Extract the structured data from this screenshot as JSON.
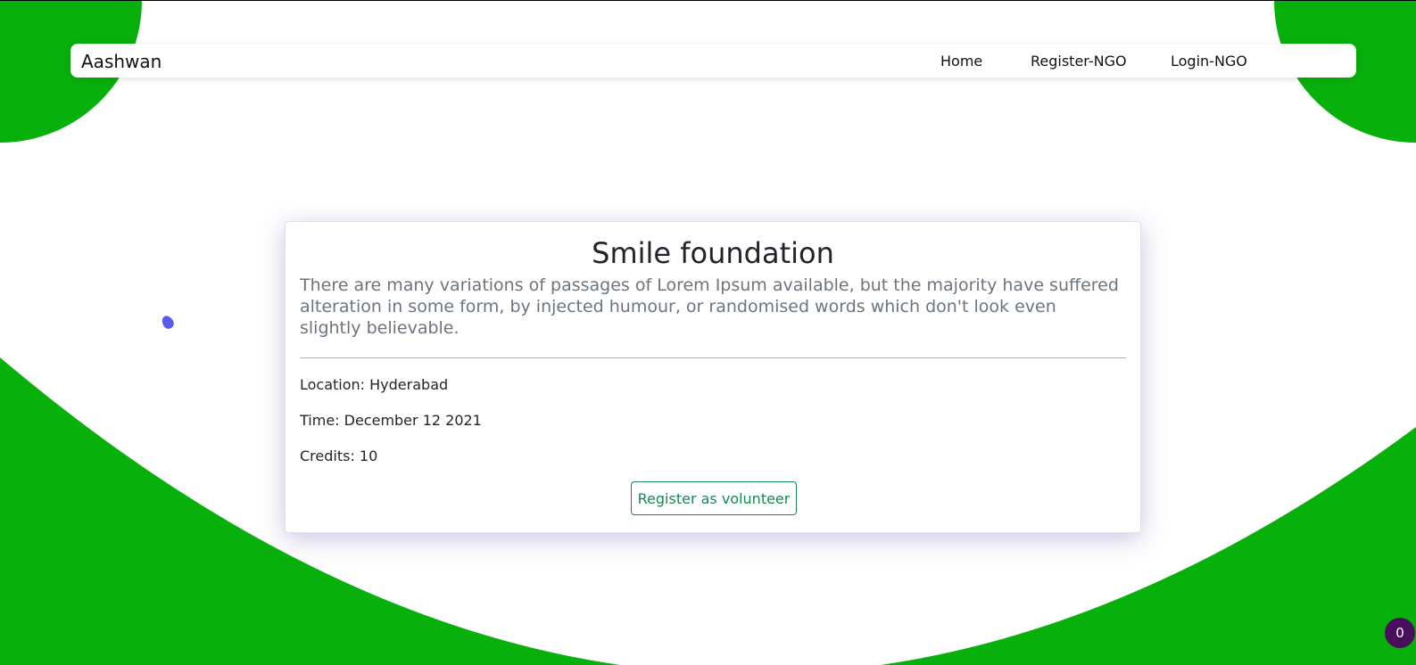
{
  "nav": {
    "brand": "Aashwan",
    "links": [
      "Home",
      "Register-NGO",
      "Login-NGO"
    ]
  },
  "card": {
    "title": "Smile foundation",
    "description": "There are many variations of passages of Lorem Ipsum available, but the majority have suffered alteration in some form, by injected humour, or randomised words which don't look even slightly believable.",
    "location": "Location: Hyderabad",
    "time": "Time: December 12 2021",
    "credits": "Credits: 10",
    "button_label": "Register as volunteer"
  },
  "badge": {
    "count": "0"
  },
  "colors": {
    "background_green": "#08b00b",
    "button_accent": "#198754",
    "badge_bg": "#4a0f5a"
  }
}
